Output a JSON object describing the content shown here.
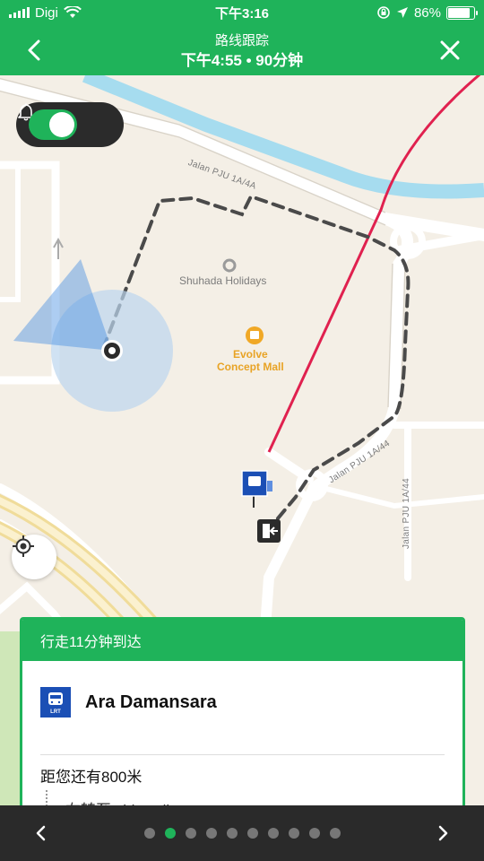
{
  "status_bar": {
    "carrier": "Digi",
    "time": "下午3:16",
    "battery": "86%",
    "battery_level": 0.86
  },
  "nav": {
    "title": "路线跟踪",
    "subtitle": "下午4:55 • 90分钟"
  },
  "map": {
    "road_top": "Jalan PJU 1A/4A",
    "road_diag": "Jalan PJU 1A/44",
    "road_vertical": "Jalan PJU 1A/44",
    "poi_holidays": "Shuhada Holidays",
    "poi_mall_line1": "Evolve",
    "poi_mall_line2": "Concept Mall",
    "route_color": "#e0214f",
    "walk_color": "#4a4a4a"
  },
  "alert_toggle": {
    "on": true
  },
  "card": {
    "header": "行走11分钟到达",
    "station": "Ara Damansara",
    "station_badge": "LRT",
    "distance": "距您还有800米",
    "instruction": "右转至 sidewalk"
  },
  "pager": {
    "page_count": 10,
    "active_index": 1
  },
  "colors": {
    "primary": "#1fb35a",
    "dark": "#2a2a2a"
  }
}
